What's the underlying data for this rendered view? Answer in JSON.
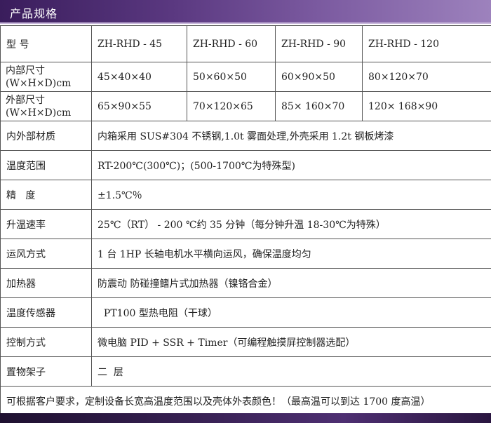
{
  "header": {
    "title": "产品规格"
  },
  "models": {
    "label": "型 号",
    "values": [
      "ZH-RHD - 45",
      "ZH-RHD - 60",
      "ZH-RHD - 90",
      "ZH-RHD - 120"
    ]
  },
  "inner_size": {
    "label_line1": "内部尺寸",
    "label_line2": "(W×H×D)cm",
    "values": [
      "45×40×40",
      "50×60×50",
      "60×90×50",
      "80×120×70"
    ]
  },
  "outer_size": {
    "label_line1": "外部尺寸",
    "label_line2": "(W×H×D)cm",
    "values": [
      "65×90×55",
      "70×120×65",
      "85× 160×70",
      "120× 168×90"
    ]
  },
  "specs": [
    {
      "label": "内外部材质",
      "value": "内箱采用 SUS#304 不锈钢,1.0t 雾面处理,外壳采用 1.2t 钢板烤漆"
    },
    {
      "label": "温度范围",
      "value": "RT-200℃(300℃)；(500-1700℃为特殊型)"
    },
    {
      "label": "精   度",
      "value": "±1.5℃％"
    },
    {
      "label": "升温速率",
      "value": "25℃（RT） - 200 ℃约  35 分钟（每分钟升温 18-30℃为特殊）"
    },
    {
      "label": "运风方式",
      "value": "1 台 1HP 长轴电机水平横向运风，确保温度均匀"
    },
    {
      "label": "加热器",
      "value": "防震动  防碰撞鳍片式加热器（镍铬合金）"
    },
    {
      "label": "温度传感器",
      "value": "  PT100 型热电阻（干球）"
    },
    {
      "label": "控制方式",
      "value": "微电脑 PID + SSR + Timer（可编程触摸屏控制器选配）"
    },
    {
      "label": "置物架子",
      "value": "二  层"
    }
  ],
  "note": "可根据客户要求，定制设备长宽高温度范围以及壳体外表颜色！（最高温可以到达 1700 度高温）"
}
